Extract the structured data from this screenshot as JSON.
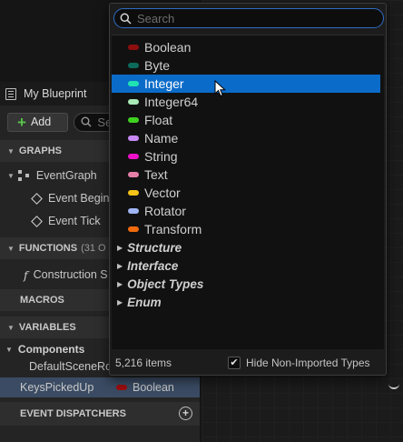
{
  "panel": {
    "title": "My Blueprint",
    "add_label": "Add",
    "search_placeholder": "Se"
  },
  "sections": {
    "graphs": "GRAPHS",
    "functions": "FUNCTIONS",
    "functions_count": "(31 O",
    "macros": "MACROS",
    "variables": "VARIABLES",
    "event_dispatchers": "EVENT DISPATCHERS"
  },
  "graphs_items": {
    "event_graph": "EventGraph",
    "event_begin": "Event Begin",
    "event_tick": "Event Tick"
  },
  "functions_items": {
    "construction": "Construction S"
  },
  "variables_items": {
    "components": "Components",
    "default_scene_root": "DefaultSceneRo",
    "selected_var_name": "KeysPickedUp",
    "selected_var_type": "Boolean"
  },
  "popup": {
    "search_placeholder": "Search",
    "types": [
      {
        "label": "Boolean",
        "color": "#8e0e0e"
      },
      {
        "label": "Byte",
        "color": "#0c6b5a"
      },
      {
        "label": "Integer",
        "color": "#20e3b2"
      },
      {
        "label": "Integer64",
        "color": "#a7e9b7"
      },
      {
        "label": "Float",
        "color": "#3fd11f"
      },
      {
        "label": "Name",
        "color": "#c889f5"
      },
      {
        "label": "String",
        "color": "#ee11c8"
      },
      {
        "label": "Text",
        "color": "#e67fa8"
      },
      {
        "label": "Vector",
        "color": "#f5c319"
      },
      {
        "label": "Rotator",
        "color": "#9fb5f5"
      },
      {
        "label": "Transform",
        "color": "#f06a0e"
      }
    ],
    "groups": [
      "Structure",
      "Interface",
      "Object Types",
      "Enum"
    ],
    "hovered_index": 2,
    "footer_count": "5,216 items",
    "hide_non_imported_label": "Hide Non-Imported Types",
    "hide_non_imported_checked": true
  }
}
